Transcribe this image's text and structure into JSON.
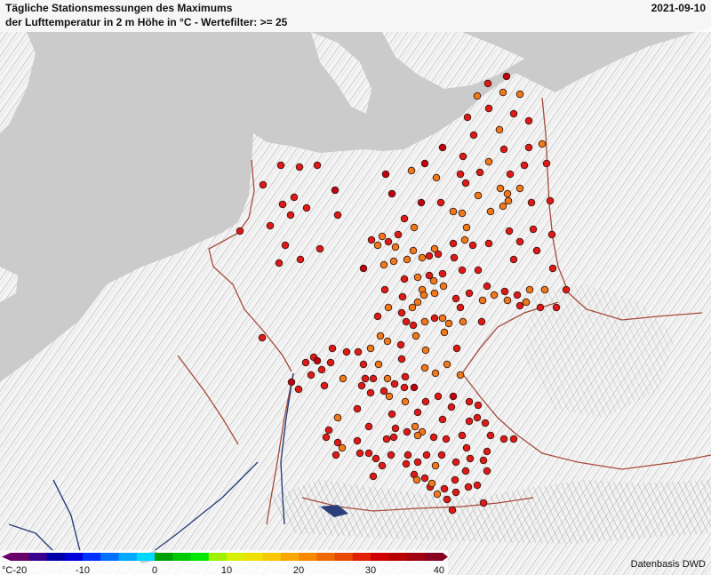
{
  "header": {
    "title_line1": "Tägliche Stationsmessungen des Maximums",
    "title_line2": "der Lufttemperatur in 2 m Höhe in °C - Wertefilter: >= 25",
    "date": "2021-09-10"
  },
  "credit": "Datenbasis DWD",
  "legend": {
    "unit": "°C",
    "tick_labels": [
      "-20",
      "-10",
      "0",
      "10",
      "20",
      "30",
      "40"
    ],
    "tick_values": [
      -20,
      -10,
      0,
      10,
      20,
      30,
      40
    ],
    "min": -20,
    "max": 40,
    "colors": [
      "#6a006a",
      "#3a0090",
      "#0000a8",
      "#0000d8",
      "#0030ff",
      "#0070ff",
      "#00a8ff",
      "#00d8ff",
      "#00a000",
      "#00c800",
      "#00e800",
      "#a0f000",
      "#d8f000",
      "#f0e000",
      "#f8c800",
      "#f8a800",
      "#f88800",
      "#f06800",
      "#e84800",
      "#e02000",
      "#d00000",
      "#b80000",
      "#a00010",
      "#880020"
    ]
  },
  "colors": {
    "sea": "#cbcbcb",
    "land": "#f2f2f2",
    "border": "#a64a3a",
    "river": "#2a3f7a",
    "station_orange": "#f07a1a",
    "station_red": "#e01818",
    "station_darkred": "#c00010"
  },
  "stations": [
    [
      570,
      86,
      2
    ],
    [
      549,
      94,
      1
    ],
    [
      537,
      108,
      0
    ],
    [
      566,
      104,
      0
    ],
    [
      585,
      106,
      0
    ],
    [
      550,
      122,
      1
    ],
    [
      526,
      132,
      1
    ],
    [
      578,
      128,
      1
    ],
    [
      595,
      136,
      1
    ],
    [
      562,
      146,
      0
    ],
    [
      533,
      152,
      1
    ],
    [
      610,
      162,
      0
    ],
    [
      498,
      166,
      2
    ],
    [
      595,
      166,
      1
    ],
    [
      567,
      168,
      1
    ],
    [
      521,
      176,
      1
    ],
    [
      478,
      184,
      2
    ],
    [
      550,
      182,
      0
    ],
    [
      590,
      186,
      1
    ],
    [
      615,
      184,
      1
    ],
    [
      463,
      192,
      0
    ],
    [
      434,
      196,
      2
    ],
    [
      491,
      200,
      0
    ],
    [
      518,
      196,
      1
    ],
    [
      540,
      194,
      1
    ],
    [
      574,
      196,
      1
    ],
    [
      524,
      206,
      1
    ],
    [
      563,
      212,
      0
    ],
    [
      585,
      212,
      0
    ],
    [
      441,
      218,
      2
    ],
    [
      538,
      220,
      0
    ],
    [
      571,
      218,
      0
    ],
    [
      496,
      228,
      1
    ],
    [
      510,
      238,
      0
    ],
    [
      520,
      240,
      0
    ],
    [
      552,
      238,
      0
    ],
    [
      566,
      232,
      0
    ],
    [
      572,
      226,
      0
    ],
    [
      598,
      228,
      1
    ],
    [
      619,
      226,
      1
    ],
    [
      474,
      228,
      2
    ],
    [
      455,
      246,
      1
    ],
    [
      466,
      256,
      0
    ],
    [
      448,
      264,
      1
    ],
    [
      525,
      256,
      0
    ],
    [
      550,
      274,
      1
    ],
    [
      573,
      260,
      1
    ],
    [
      600,
      258,
      1
    ],
    [
      621,
      264,
      1
    ],
    [
      430,
      266,
      0
    ],
    [
      418,
      270,
      1
    ],
    [
      425,
      276,
      0
    ],
    [
      437,
      272,
      1
    ],
    [
      445,
      278,
      0
    ],
    [
      465,
      282,
      0
    ],
    [
      489,
      280,
      0
    ],
    [
      510,
      274,
      1
    ],
    [
      523,
      270,
      0
    ],
    [
      532,
      276,
      1
    ],
    [
      585,
      272,
      1
    ],
    [
      604,
      282,
      1
    ],
    [
      578,
      292,
      1
    ],
    [
      458,
      292,
      0
    ],
    [
      475,
      290,
      0
    ],
    [
      483,
      288,
      1
    ],
    [
      493,
      286,
      1
    ],
    [
      511,
      290,
      1
    ],
    [
      443,
      294,
      0
    ],
    [
      432,
      298,
      0
    ],
    [
      409,
      302,
      2
    ],
    [
      498,
      308,
      1
    ],
    [
      470,
      312,
      0
    ],
    [
      483,
      310,
      1
    ],
    [
      520,
      304,
      1
    ],
    [
      538,
      304,
      1
    ],
    [
      622,
      302,
      1
    ],
    [
      455,
      314,
      1
    ],
    [
      488,
      316,
      0
    ],
    [
      499,
      322,
      0
    ],
    [
      489,
      330,
      0
    ],
    [
      475,
      326,
      0
    ],
    [
      433,
      326,
      1
    ],
    [
      453,
      334,
      1
    ],
    [
      470,
      340,
      0
    ],
    [
      477,
      332,
      0
    ],
    [
      513,
      336,
      1
    ],
    [
      528,
      330,
      1
    ],
    [
      548,
      322,
      1
    ],
    [
      568,
      328,
      1
    ],
    [
      582,
      332,
      1
    ],
    [
      596,
      326,
      0
    ],
    [
      613,
      326,
      0
    ],
    [
      637,
      326,
      1
    ],
    [
      556,
      332,
      0
    ],
    [
      592,
      340,
      0
    ],
    [
      608,
      346,
      1
    ],
    [
      626,
      346,
      1
    ],
    [
      585,
      344,
      1
    ],
    [
      571,
      338,
      0
    ],
    [
      543,
      338,
      0
    ],
    [
      437,
      346,
      0
    ],
    [
      452,
      352,
      1
    ],
    [
      464,
      346,
      0
    ],
    [
      478,
      362,
      0
    ],
    [
      489,
      358,
      1
    ],
    [
      498,
      358,
      0
    ],
    [
      518,
      346,
      1
    ],
    [
      465,
      366,
      1
    ],
    [
      505,
      364,
      0
    ],
    [
      521,
      362,
      0
    ],
    [
      542,
      362,
      1
    ],
    [
      425,
      356,
      1
    ],
    [
      457,
      362,
      1
    ],
    [
      428,
      378,
      0
    ],
    [
      451,
      388,
      1
    ],
    [
      436,
      384,
      0
    ],
    [
      468,
      378,
      0
    ],
    [
      500,
      374,
      0
    ],
    [
      514,
      392,
      1
    ],
    [
      479,
      394,
      0
    ],
    [
      417,
      392,
      0
    ],
    [
      452,
      404,
      1
    ],
    [
      426,
      410,
      0
    ],
    [
      503,
      410,
      0
    ],
    [
      478,
      414,
      0
    ],
    [
      420,
      426,
      1
    ],
    [
      456,
      424,
      1
    ],
    [
      490,
      420,
      0
    ],
    [
      436,
      426,
      0
    ],
    [
      444,
      432,
      1
    ],
    [
      518,
      422,
      0
    ],
    [
      409,
      410,
      1
    ],
    [
      403,
      396,
      1
    ],
    [
      390,
      396,
      1
    ],
    [
      374,
      392,
      1
    ],
    [
      372,
      408,
      1
    ],
    [
      353,
      402,
      1
    ],
    [
      357,
      406,
      2
    ],
    [
      344,
      408,
      1
    ],
    [
      362,
      416,
      1
    ],
    [
      350,
      422,
      1
    ],
    [
      386,
      426,
      0
    ],
    [
      411,
      426,
      1
    ],
    [
      328,
      430,
      2
    ],
    [
      336,
      438,
      1
    ],
    [
      365,
      434,
      1
    ],
    [
      407,
      434,
      1
    ],
    [
      417,
      442,
      1
    ],
    [
      432,
      440,
      1
    ],
    [
      455,
      436,
      1
    ],
    [
      466,
      436,
      2
    ],
    [
      493,
      446,
      1
    ],
    [
      510,
      446,
      2
    ],
    [
      528,
      452,
      1
    ],
    [
      438,
      446,
      0
    ],
    [
      456,
      452,
      0
    ],
    [
      479,
      452,
      1
    ],
    [
      508,
      458,
      1
    ],
    [
      538,
      456,
      1
    ],
    [
      402,
      460,
      1
    ],
    [
      470,
      464,
      1
    ],
    [
      441,
      466,
      1
    ],
    [
      380,
      470,
      0
    ],
    [
      415,
      480,
      1
    ],
    [
      445,
      482,
      1
    ],
    [
      498,
      472,
      1
    ],
    [
      528,
      474,
      1
    ],
    [
      537,
      470,
      1
    ],
    [
      546,
      476,
      1
    ],
    [
      370,
      484,
      1
    ],
    [
      367,
      492,
      1
    ],
    [
      380,
      498,
      1
    ],
    [
      402,
      496,
      1
    ],
    [
      435,
      494,
      1
    ],
    [
      443,
      492,
      1
    ],
    [
      458,
      486,
      1
    ],
    [
      467,
      480,
      0
    ],
    [
      475,
      486,
      0
    ],
    [
      520,
      490,
      1
    ],
    [
      552,
      490,
      1
    ],
    [
      567,
      494,
      1
    ],
    [
      578,
      494,
      1
    ],
    [
      470,
      490,
      0
    ],
    [
      488,
      492,
      1
    ],
    [
      502,
      494,
      1
    ],
    [
      385,
      504,
      0
    ],
    [
      378,
      512,
      1
    ],
    [
      405,
      510,
      1
    ],
    [
      415,
      510,
      1
    ],
    [
      423,
      516,
      1
    ],
    [
      440,
      512,
      1
    ],
    [
      459,
      512,
      1
    ],
    [
      470,
      520,
      1
    ],
    [
      480,
      512,
      1
    ],
    [
      497,
      512,
      1
    ],
    [
      525,
      504,
      1
    ],
    [
      548,
      508,
      1
    ],
    [
      430,
      524,
      1
    ],
    [
      457,
      522,
      1
    ],
    [
      490,
      524,
      0
    ],
    [
      513,
      520,
      1
    ],
    [
      529,
      516,
      1
    ],
    [
      544,
      518,
      1
    ],
    [
      420,
      536,
      1
    ],
    [
      466,
      534,
      1
    ],
    [
      478,
      538,
      1
    ],
    [
      524,
      530,
      1
    ],
    [
      548,
      530,
      1
    ],
    [
      484,
      548,
      1
    ],
    [
      492,
      556,
      0
    ],
    [
      513,
      554,
      1
    ],
    [
      527,
      548,
      1
    ],
    [
      537,
      546,
      1
    ],
    [
      503,
      562,
      1
    ],
    [
      544,
      566,
      1
    ],
    [
      509,
      574,
      1
    ],
    [
      486,
      544,
      0
    ],
    [
      512,
      540,
      1
    ],
    [
      500,
      550,
      1
    ],
    [
      469,
      540,
      0
    ],
    [
      316,
      186,
      1
    ],
    [
      337,
      188,
      1
    ],
    [
      357,
      186,
      1
    ],
    [
      296,
      208,
      1
    ],
    [
      331,
      222,
      1
    ],
    [
      377,
      214,
      2
    ],
    [
      318,
      230,
      1
    ],
    [
      345,
      234,
      1
    ],
    [
      327,
      242,
      1
    ],
    [
      380,
      242,
      1
    ],
    [
      304,
      254,
      1
    ],
    [
      270,
      260,
      1
    ],
    [
      321,
      276,
      1
    ],
    [
      338,
      292,
      1
    ],
    [
      360,
      280,
      1
    ],
    [
      314,
      296,
      1
    ],
    [
      295,
      380,
      1
    ]
  ]
}
